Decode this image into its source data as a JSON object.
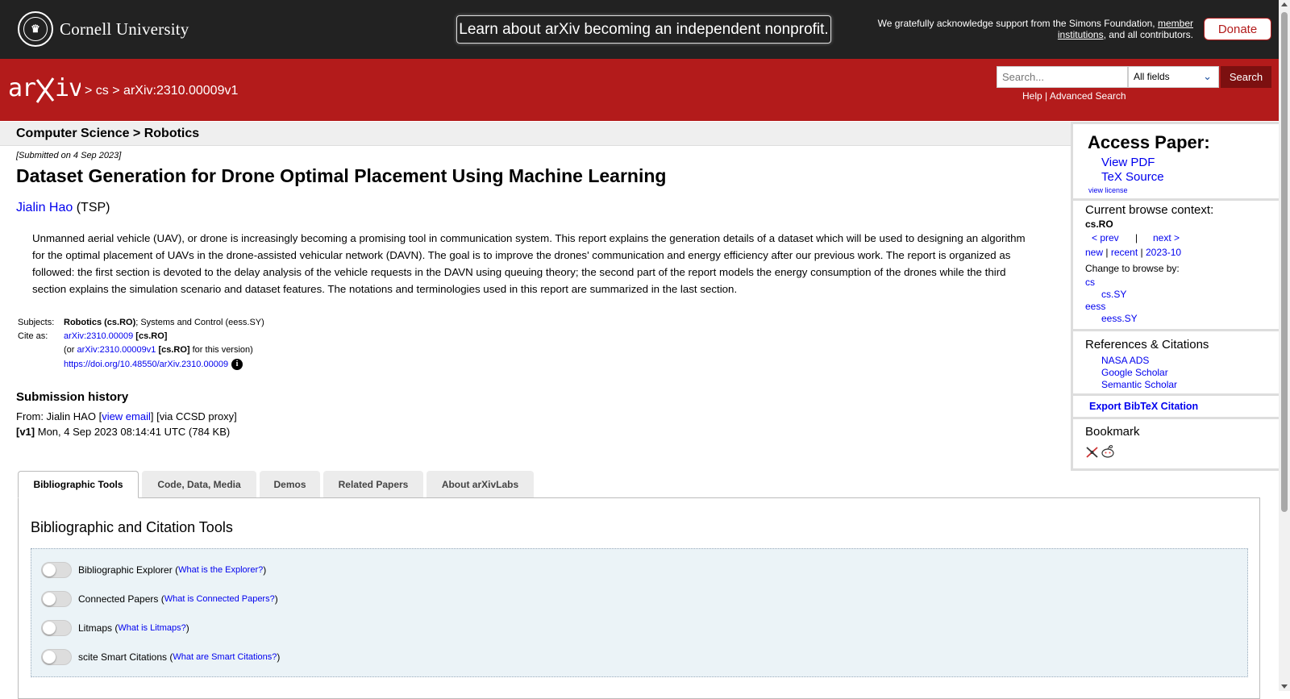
{
  "topbar": {
    "institution": "Cornell University",
    "banner": "Learn about arXiv becoming an independent nonprofit.",
    "support_prefix": "We gratefully acknowledge support from the Simons Foundation,",
    "support_link": "member institutions",
    "support_suffix": ", and all contributors.",
    "donate": "Donate"
  },
  "header": {
    "logo": "arXiv",
    "crumb_sep1": ">",
    "crumb_cs": "cs",
    "crumb_sep2": ">",
    "crumb_id": "arXiv:2310.00009v1",
    "search_placeholder": "Search...",
    "search_field": "All fields",
    "search_button": "Search",
    "help": "Help",
    "pipe": "|",
    "advanced": "Advanced Search"
  },
  "paper": {
    "category": "Computer Science > Robotics",
    "submitted": "[Submitted on 4 Sep 2023]",
    "title": "Dataset Generation for Drone Optimal Placement Using Machine Learning",
    "author": "Jialin Hao",
    "affiliation": "(TSP)",
    "abstract": "Unmanned aerial vehicle (UAV), or drone is increasingly becoming a promising tool in communication system. This report explains the generation details of a dataset which will be used to designing an algorithm for the optimal placement of UAVs in the drone-assisted vehicular network (DAVN). The goal is to improve the drones' communication and energy efficiency after our previous work. The report is organized as followed: the first section is devoted to the delay analysis of the vehicle requests in the DAVN using queuing theory; the second part of the report models the energy consumption of the drones while the third section explains the simulation scenario and dataset features. The notations and terminologies used in this report are summarized in the last section.",
    "subjects_label": "Subjects:",
    "subjects_primary": "Robotics (cs.RO)",
    "subjects_rest": "; Systems and Control (eess.SY)",
    "cite_label": "Cite as:",
    "cite_id": "arXiv:2310.00009",
    "cite_cat": "[cs.RO]",
    "cite_or": "(or",
    "cite_version": "arXiv:2310.00009v1",
    "cite_version_cat": "[cs.RO]",
    "cite_version_suffix": "for this version)",
    "doi": "https://doi.org/10.48550/arXiv.2310.00009",
    "history_heading": "Submission history",
    "history_from": "From: Jialin HAO [",
    "history_email": "view email",
    "history_proxy": "] [via CCSD proxy]",
    "history_v1_tag": "[v1]",
    "history_v1": "Mon, 4 Sep 2023 08:14:41 UTC (784 KB)"
  },
  "sidebar": {
    "access_heading": "Access Paper:",
    "view_pdf": "View PDF",
    "tex_source": "TeX Source",
    "view_license": "view license",
    "context_heading": "Current browse context:",
    "context": "cs.RO",
    "prev": "< prev",
    "sep": "|",
    "next": "next >",
    "new": "new",
    "recent": "recent",
    "month": "2023-10",
    "change_label": "Change to browse by:",
    "browse": [
      "cs",
      "cs.SY",
      "eess",
      "eess.SY"
    ],
    "refs_heading": "References & Citations",
    "refs": [
      "NASA ADS",
      "Google Scholar",
      "Semantic Scholar"
    ],
    "export": "Export BibTeX Citation",
    "bookmark_heading": "Bookmark"
  },
  "tabs": [
    "Bibliographic Tools",
    "Code, Data, Media",
    "Demos",
    "Related Papers",
    "About arXivLabs"
  ],
  "tools": {
    "heading": "Bibliographic and Citation Tools",
    "items": [
      {
        "label": "Bibliographic Explorer",
        "link": "What is the Explorer?"
      },
      {
        "label": "Connected Papers",
        "link": "What is Connected Papers?"
      },
      {
        "label": "Litmaps",
        "link": "What is Litmaps?"
      },
      {
        "label": "scite Smart Citations",
        "link": "What are Smart Citations?"
      }
    ]
  },
  "colors": {
    "brand_red": "#b31b1b",
    "dark_banner": "#222222",
    "link_blue": "#0000ee"
  },
  "icons": [
    "cornell-seal-icon",
    "info-icon",
    "chevron-down-icon",
    "bibsonomy-icon",
    "reddit-icon"
  ]
}
